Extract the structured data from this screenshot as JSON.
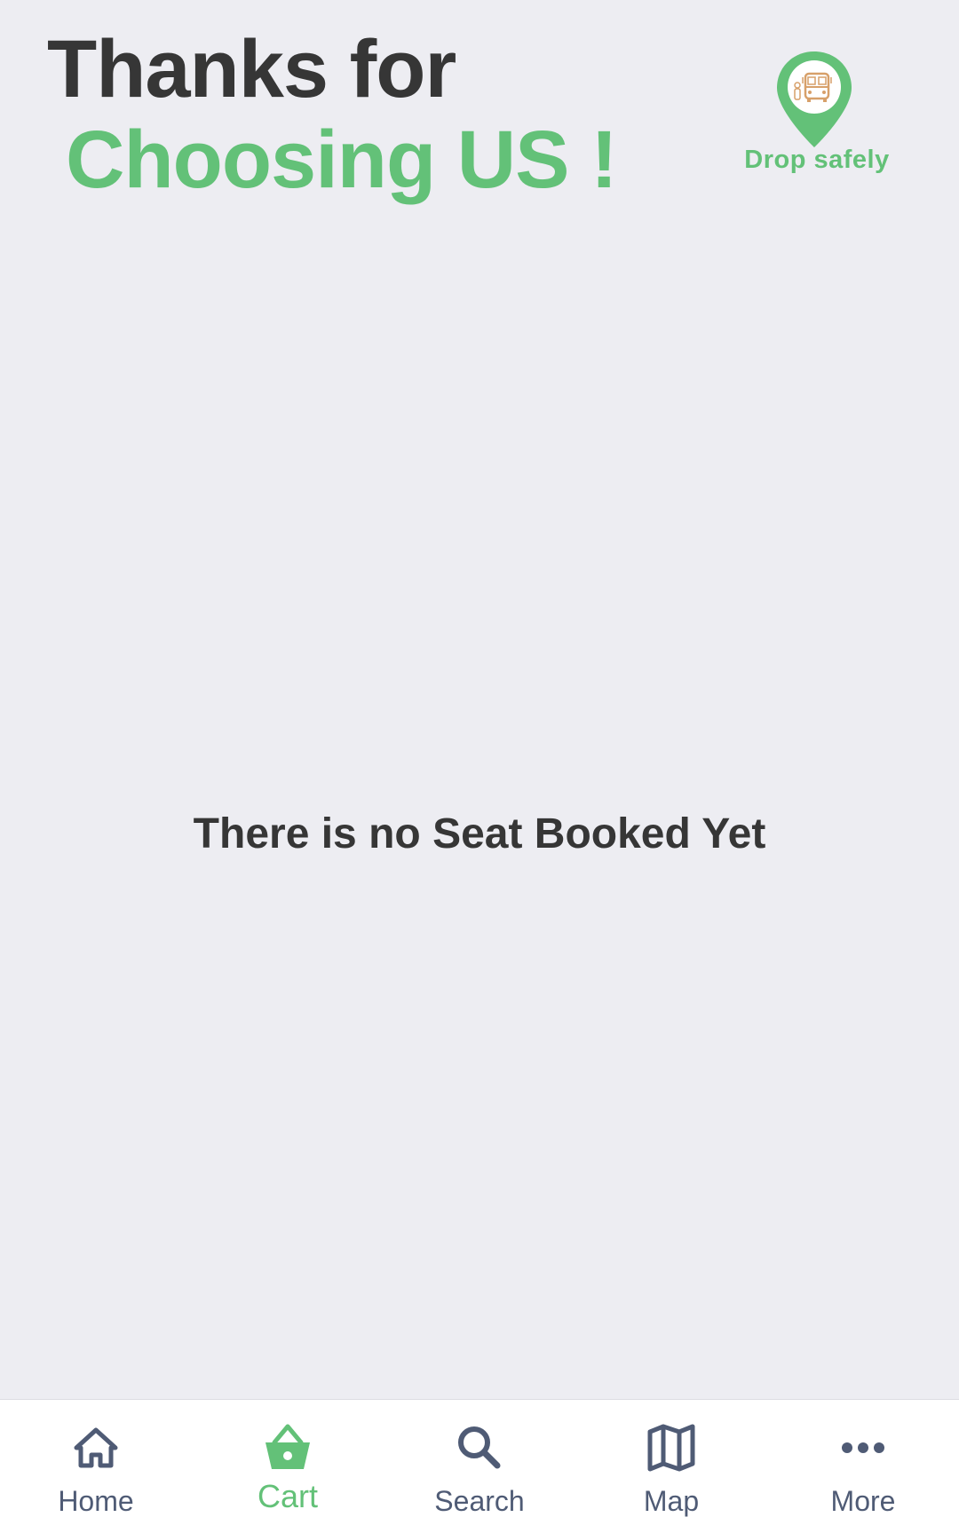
{
  "header": {
    "title_line1": "Thanks for",
    "title_line2": "Choosing US !"
  },
  "logo": {
    "text": "Drop safely",
    "icon": "bus-location-pin-icon"
  },
  "main": {
    "empty_message": "There is no Seat Booked Yet"
  },
  "bottom_nav": {
    "active": "Cart",
    "items": [
      {
        "label": "Home",
        "icon": "home-icon"
      },
      {
        "label": "Cart",
        "icon": "basket-icon"
      },
      {
        "label": "Search",
        "icon": "search-icon"
      },
      {
        "label": "Map",
        "icon": "map-icon"
      },
      {
        "label": "More",
        "icon": "more-dots-icon"
      }
    ]
  },
  "colors": {
    "background": "#ededf2",
    "text_dark": "#363636",
    "accent_green": "#63c178",
    "nav_inactive": "#4f5b75",
    "logo_bus": "#d7a06a",
    "nav_background": "#ffffff"
  }
}
